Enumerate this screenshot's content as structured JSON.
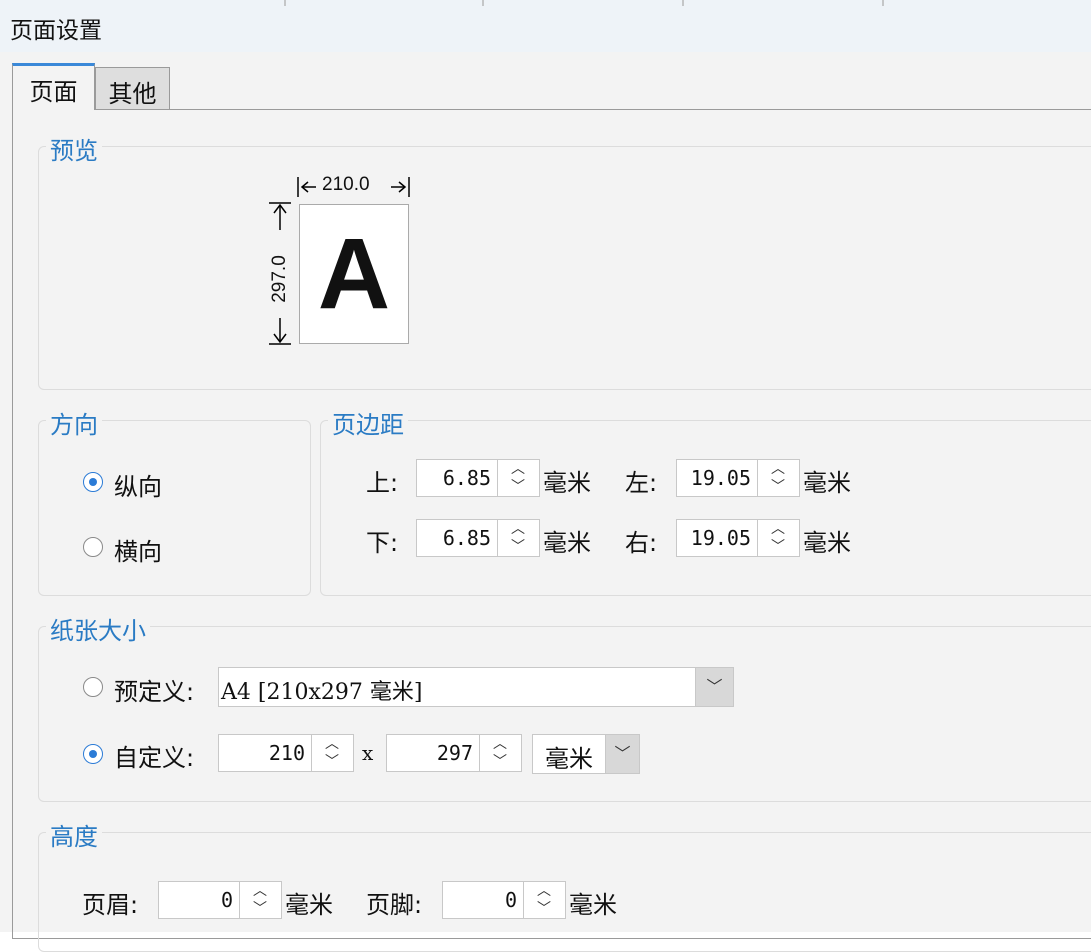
{
  "window": {
    "title": "页面设置"
  },
  "tabs": [
    {
      "label": "页面"
    },
    {
      "label": "其他"
    }
  ],
  "preview": {
    "legend": "预览",
    "width_label": "210.0",
    "height_label": "297.0",
    "letter": "A"
  },
  "orientation": {
    "legend": "方向",
    "options": [
      {
        "label": "纵向",
        "checked": true
      },
      {
        "label": "横向",
        "checked": false
      }
    ]
  },
  "margins": {
    "legend": "页边距",
    "top": {
      "label": "上:",
      "value": "6.85",
      "unit": "毫米"
    },
    "bottom": {
      "label": "下:",
      "value": "6.85",
      "unit": "毫米"
    },
    "left": {
      "label": "左:",
      "value": "19.05",
      "unit": "毫米"
    },
    "right": {
      "label": "右:",
      "value": "19.05",
      "unit": "毫米"
    }
  },
  "paper_size": {
    "legend": "纸张大小",
    "predefined": {
      "label": "预定义:",
      "value": "A4 [210x297 毫米]",
      "checked": false
    },
    "custom": {
      "label": "自定义:",
      "width": "210",
      "times": "x",
      "height": "297",
      "unit": "毫米",
      "checked": true
    }
  },
  "height": {
    "legend": "高度",
    "header": {
      "label": "页眉:",
      "value": "0",
      "unit": "毫米"
    },
    "footer": {
      "label": "页脚:",
      "value": "0",
      "unit": "毫米"
    }
  },
  "colors": {
    "accent": "#2a7bc4",
    "radio": "#2b7bd6",
    "tab_highlight": "#3a88d8"
  }
}
